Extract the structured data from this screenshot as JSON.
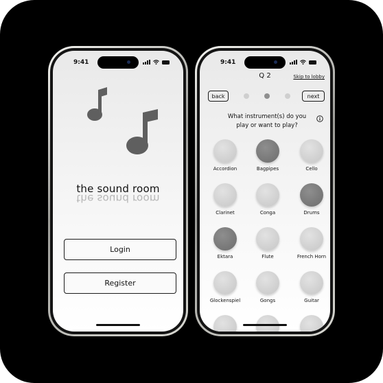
{
  "left_phone": {
    "status_time": "9:41",
    "app_title": "the sound room",
    "login_label": "Login",
    "register_label": "Register"
  },
  "right_phone": {
    "status_time": "9:41",
    "question_number": "Q 2",
    "skip_label": "Skip to lobby",
    "back_label": "back",
    "next_label": "next",
    "progress": {
      "total": 3,
      "current": 2
    },
    "question_line1": "What instrument(s) do you",
    "question_line2": "play or want to play?",
    "instruments": [
      {
        "label": "Accordion",
        "selected": false
      },
      {
        "label": "Bagpipes",
        "selected": true
      },
      {
        "label": "Cello",
        "selected": false
      },
      {
        "label": "Clarinet",
        "selected": false
      },
      {
        "label": "Conga",
        "selected": false
      },
      {
        "label": "Drums",
        "selected": true
      },
      {
        "label": "Ektara",
        "selected": true
      },
      {
        "label": "Flute",
        "selected": false
      },
      {
        "label": "French Horn",
        "selected": false
      },
      {
        "label": "Glockenspiel",
        "selected": false
      },
      {
        "label": "Gongs",
        "selected": false
      },
      {
        "label": "Guitar",
        "selected": false
      },
      {
        "label": "",
        "selected": false
      },
      {
        "label": "",
        "selected": false
      },
      {
        "label": "",
        "selected": false
      }
    ]
  },
  "colors": {
    "background": "#000000",
    "selected_circle": "#7a7a7a",
    "unselected_circle": "#d2d2d2",
    "text": "#111111"
  }
}
